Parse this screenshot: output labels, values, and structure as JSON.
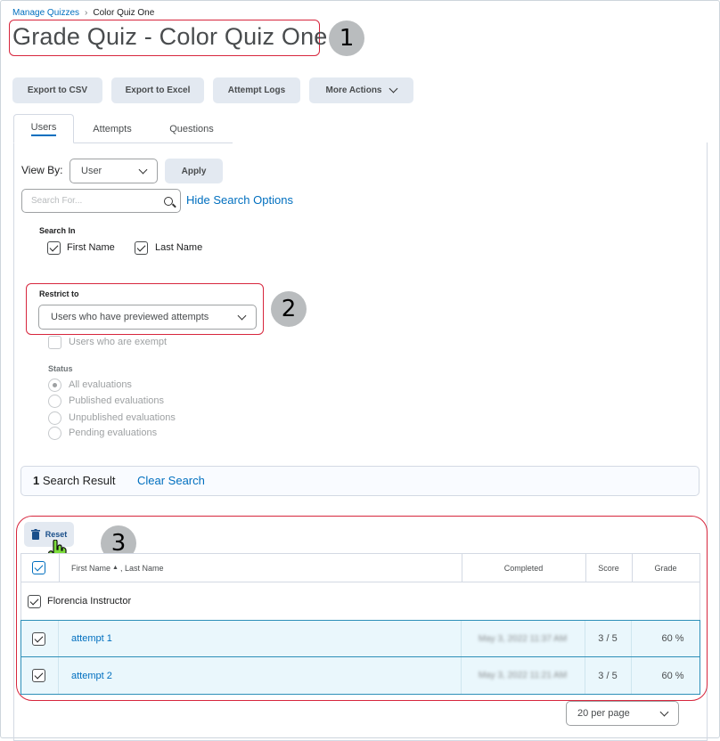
{
  "breadcrumb": {
    "parent": "Manage Quizzes",
    "separator": "›",
    "current": "Color Quiz One"
  },
  "page_title": "Grade Quiz - Color Quiz One",
  "callouts": [
    "1",
    "2",
    "3"
  ],
  "toolbar": {
    "export_csv": "Export to CSV",
    "export_excel": "Export to Excel",
    "attempt_logs": "Attempt Logs",
    "more_actions": "More Actions"
  },
  "tabs": [
    {
      "label": "Users",
      "active": true
    },
    {
      "label": "Attempts",
      "active": false
    },
    {
      "label": "Questions",
      "active": false
    }
  ],
  "filters": {
    "view_by_label": "View By:",
    "view_by_value": "User",
    "apply": "Apply",
    "search_placeholder": "Search For...",
    "hide_search_options": "Hide Search Options",
    "search_in_label": "Search In",
    "first_name": "First Name",
    "last_name": "Last Name",
    "restrict_to_label": "Restrict to",
    "restrict_to_value": "Users who have previewed attempts",
    "exempt": "Users who are exempt",
    "status_label": "Status",
    "status_options": [
      "All evaluations",
      "Published evaluations",
      "Unpublished evaluations",
      "Pending evaluations"
    ]
  },
  "results": {
    "count": "1",
    "text": "Search Result",
    "clear": "Clear Search"
  },
  "reset_button": "Reset",
  "table": {
    "headers": {
      "name_first": "First Name",
      "sort_indicator": "▲",
      "name_last": ", Last Name",
      "completed": "Completed",
      "score": "Score",
      "grade": "Grade"
    },
    "user": "Florencia Instructor",
    "attempts": [
      {
        "label": "attempt 1",
        "completed": "May 3, 2022 11:37 AM",
        "score": "3 / 5",
        "grade": "60 %"
      },
      {
        "label": "attempt 2",
        "completed": "May 3, 2022 11:21 AM",
        "score": "3 / 5",
        "grade": "60 %"
      }
    ]
  },
  "pager": {
    "per_page": "20 per page"
  },
  "colors": {
    "link": "#006fbf",
    "callout": "#d7263d",
    "button_bg": "#e3e9f1",
    "selected_row": "#eaf7fc"
  },
  "icons": [
    "chevron-down-icon",
    "search-icon",
    "trash-icon",
    "hand-cursor-icon",
    "sort-up-icon"
  ]
}
